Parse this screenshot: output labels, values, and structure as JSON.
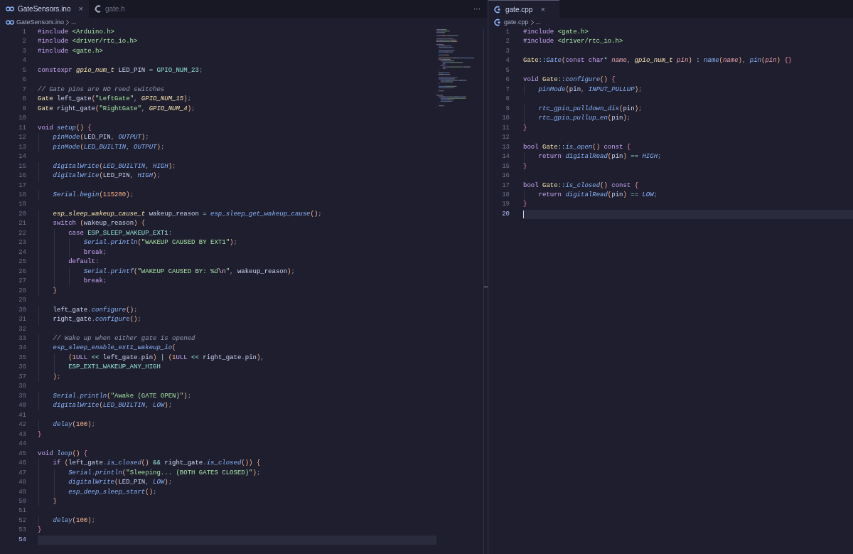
{
  "panes": [
    {
      "focused": false,
      "more_actions": "···",
      "tabs": [
        {
          "label": "GateSensors.ino",
          "kind": "ino",
          "selected": true,
          "close": "×"
        },
        {
          "label": "gate.h",
          "kind": "h",
          "selected": false
        }
      ],
      "breadcrumb": {
        "kind": "ino",
        "items": [
          "GateSensors.ino",
          "..."
        ]
      },
      "lines": [
        {
          "n": "1",
          "current": false,
          "tokens": [
            {
              "text": "#include ",
              "kind": "kw"
            },
            {
              "text": "<Arduino.h>",
              "kind": "str"
            }
          ]
        },
        {
          "n": "2",
          "current": false,
          "tokens": [
            {
              "text": "#include ",
              "kind": "kw"
            },
            {
              "text": "<driver/rtc_io.h>",
              "kind": "str"
            }
          ]
        },
        {
          "n": "3",
          "current": false,
          "tokens": [
            {
              "text": "#include ",
              "kind": "kw"
            },
            {
              "text": "<gate.h>",
              "kind": "str"
            }
          ]
        },
        {
          "n": "4",
          "current": false
        },
        {
          "n": "5",
          "current": false,
          "tokens": [
            {
              "text": "constexpr ",
              "kind": "kw"
            },
            {
              "text": "gpio_num_t",
              "kind": "type"
            },
            {
              "text": " LED_PIN ",
              "kind": "var"
            },
            {
              "text": "= ",
              "kind": "op"
            },
            {
              "text": "GPIO_NUM_23",
              "kind": "const"
            },
            {
              "text": ";",
              "kind": "punc"
            }
          ]
        },
        {
          "n": "6",
          "current": false
        },
        {
          "n": "7",
          "current": false,
          "tokens": [
            {
              "text": "// Gate pins are NO reed switches",
              "kind": "com"
            }
          ]
        },
        {
          "n": "8",
          "current": false,
          "tokens": [
            {
              "text": "Gate",
              "kind": "cls"
            },
            {
              "text": " left_gate",
              "kind": "var"
            },
            {
              "text": "(",
              "kind": "paren"
            },
            {
              "text": "\"LeftGate\"",
              "kind": "str"
            },
            {
              "text": ", ",
              "kind": "punc"
            },
            {
              "text": "GPIO_NUM_15",
              "kind": "type"
            },
            {
              "text": ")",
              "kind": "paren"
            },
            {
              "text": ";",
              "kind": "punc"
            }
          ]
        },
        {
          "n": "9",
          "current": false,
          "tokens": [
            {
              "text": "Gate",
              "kind": "cls"
            },
            {
              "text": " right_gate",
              "kind": "var"
            },
            {
              "text": "(",
              "kind": "paren"
            },
            {
              "text": "\"RightGate\"",
              "kind": "str"
            },
            {
              "text": ", ",
              "kind": "punc"
            },
            {
              "text": "GPIO_NUM_4",
              "kind": "type"
            },
            {
              "text": ")",
              "kind": "paren"
            },
            {
              "text": ";",
              "kind": "punc"
            }
          ]
        },
        {
          "n": "10",
          "current": false
        },
        {
          "n": "11",
          "current": false,
          "tokens": [
            {
              "text": "void ",
              "kind": "kw"
            },
            {
              "text": "setup",
              "kind": "fn"
            },
            {
              "text": "() ",
              "kind": "paren"
            },
            {
              "text": "{",
              "kind": "brace"
            }
          ]
        },
        {
          "n": "12",
          "current": false,
          "tokens": [
            {
              "text": "    pinMode",
              "kind": "fn"
            },
            {
              "text": "(",
              "kind": "paren"
            },
            {
              "text": "LED_PIN",
              "kind": "var"
            },
            {
              "text": ", ",
              "kind": "punc"
            },
            {
              "text": "OUTPUT",
              "kind": "mac"
            },
            {
              "text": ")",
              "kind": "paren"
            },
            {
              "text": ";",
              "kind": "punc"
            }
          ]
        },
        {
          "n": "13",
          "current": false,
          "tokens": [
            {
              "text": "    pinMode",
              "kind": "fn"
            },
            {
              "text": "(",
              "kind": "paren"
            },
            {
              "text": "LED_BUILTIN",
              "kind": "mac"
            },
            {
              "text": ", ",
              "kind": "punc"
            },
            {
              "text": "OUTPUT",
              "kind": "mac"
            },
            {
              "text": ")",
              "kind": "paren"
            },
            {
              "text": ";",
              "kind": "punc"
            }
          ]
        },
        {
          "n": "14",
          "current": false
        },
        {
          "n": "15",
          "current": false,
          "tokens": [
            {
              "text": "    digitalWrite",
              "kind": "fn"
            },
            {
              "text": "(",
              "kind": "paren"
            },
            {
              "text": "LED_BUILTIN",
              "kind": "mac"
            },
            {
              "text": ", ",
              "kind": "punc"
            },
            {
              "text": "HIGH",
              "kind": "mac"
            },
            {
              "text": ")",
              "kind": "paren"
            },
            {
              "text": ";",
              "kind": "punc"
            }
          ]
        },
        {
          "n": "16",
          "current": false,
          "tokens": [
            {
              "text": "    digitalWrite",
              "kind": "fn"
            },
            {
              "text": "(",
              "kind": "paren"
            },
            {
              "text": "LED_PIN",
              "kind": "var"
            },
            {
              "text": ", ",
              "kind": "punc"
            },
            {
              "text": "HIGH",
              "kind": "mac"
            },
            {
              "text": ")",
              "kind": "paren"
            },
            {
              "text": ";",
              "kind": "punc"
            }
          ]
        },
        {
          "n": "17",
          "current": false
        },
        {
          "n": "18",
          "current": false,
          "tokens": [
            {
              "text": "    Serial",
              "kind": "mac"
            },
            {
              "text": ".",
              "kind": "punc"
            },
            {
              "text": "begin",
              "kind": "fn"
            },
            {
              "text": "(",
              "kind": "paren"
            },
            {
              "text": "115200",
              "kind": "num"
            },
            {
              "text": ")",
              "kind": "paren"
            },
            {
              "text": ";",
              "kind": "punc"
            }
          ]
        },
        {
          "n": "19",
          "current": false
        },
        {
          "n": "20",
          "current": false,
          "tokens": [
            {
              "text": "    esp_sleep_wakeup_cause_t",
              "kind": "type"
            },
            {
              "text": " wakeup_reason ",
              "kind": "var"
            },
            {
              "text": "= ",
              "kind": "op"
            },
            {
              "text": "esp_sleep_get_wakeup_cause",
              "kind": "fn"
            },
            {
              "text": "()",
              "kind": "paren"
            },
            {
              "text": ";",
              "kind": "punc"
            }
          ]
        },
        {
          "n": "21",
          "current": false,
          "tokens": [
            {
              "text": "    switch ",
              "kind": "kw"
            },
            {
              "text": "(",
              "kind": "paren"
            },
            {
              "text": "wakeup_reason",
              "kind": "var"
            },
            {
              "text": ") {",
              "kind": "paren"
            }
          ]
        },
        {
          "n": "22",
          "current": false,
          "tokens": [
            {
              "text": "        case ",
              "kind": "kw"
            },
            {
              "text": "ESP_SLEEP_WAKEUP_EXT1",
              "kind": "const"
            },
            {
              "text": ":",
              "kind": "punc"
            }
          ]
        },
        {
          "n": "23",
          "current": false,
          "tokens": [
            {
              "text": "            Serial",
              "kind": "mac"
            },
            {
              "text": ".",
              "kind": "punc"
            },
            {
              "text": "println",
              "kind": "fn"
            },
            {
              "text": "(",
              "kind": "paren"
            },
            {
              "text": "\"WAKEUP CAUSED BY EXT1\"",
              "kind": "str"
            },
            {
              "text": ")",
              "kind": "paren"
            },
            {
              "text": ";",
              "kind": "punc"
            }
          ]
        },
        {
          "n": "24",
          "current": false,
          "tokens": [
            {
              "text": "            break",
              "kind": "kw"
            },
            {
              "text": ";",
              "kind": "punc"
            }
          ]
        },
        {
          "n": "25",
          "current": false,
          "tokens": [
            {
              "text": "        default",
              "kind": "kw"
            },
            {
              "text": ":",
              "kind": "punc"
            }
          ]
        },
        {
          "n": "26",
          "current": false,
          "tokens": [
            {
              "text": "            Serial",
              "kind": "mac"
            },
            {
              "text": ".",
              "kind": "punc"
            },
            {
              "text": "printf",
              "kind": "fn"
            },
            {
              "text": "(",
              "kind": "paren"
            },
            {
              "text": "\"WAKEUP CAUSED BY: %d",
              "kind": "str"
            },
            {
              "text": "\\n",
              "kind": "esc"
            },
            {
              "text": "\"",
              "kind": "str"
            },
            {
              "text": ",",
              "kind": "punc"
            },
            {
              "text": " wakeup_reason",
              "kind": "var"
            },
            {
              "text": ")",
              "kind": "paren"
            },
            {
              "text": ";",
              "kind": "punc"
            }
          ]
        },
        {
          "n": "27",
          "current": false,
          "tokens": [
            {
              "text": "            break",
              "kind": "kw"
            },
            {
              "text": ";",
              "kind": "punc"
            }
          ]
        },
        {
          "n": "28",
          "current": false,
          "tokens": [
            {
              "text": "    }",
              "kind": "paren"
            }
          ]
        },
        {
          "n": "29",
          "current": false
        },
        {
          "n": "30",
          "current": false,
          "tokens": [
            {
              "text": "    left_gate",
              "kind": "var"
            },
            {
              "text": ".",
              "kind": "punc"
            },
            {
              "text": "configure",
              "kind": "fn"
            },
            {
              "text": "()",
              "kind": "paren"
            },
            {
              "text": ";",
              "kind": "punc"
            }
          ]
        },
        {
          "n": "31",
          "current": false,
          "tokens": [
            {
              "text": "    right_gate",
              "kind": "var"
            },
            {
              "text": ".",
              "kind": "punc"
            },
            {
              "text": "configure",
              "kind": "fn"
            },
            {
              "text": "()",
              "kind": "paren"
            },
            {
              "text": ";",
              "kind": "punc"
            }
          ]
        },
        {
          "n": "32",
          "current": false
        },
        {
          "n": "33",
          "current": false,
          "tokens": [
            {
              "text": "    // Wake up when either gate is opened",
              "kind": "com"
            }
          ]
        },
        {
          "n": "34",
          "current": false,
          "tokens": [
            {
              "text": "    esp_sleep_enable_ext1_wakeup_io",
              "kind": "fn"
            },
            {
              "text": "(",
              "kind": "paren"
            }
          ]
        },
        {
          "n": "35",
          "current": false,
          "tokens": [
            {
              "text": "        (",
              "kind": "paren"
            },
            {
              "text": "1",
              "kind": "num"
            },
            {
              "text": "ULL ",
              "kind": "kw"
            },
            {
              "text": "<<",
              "kind": "op"
            },
            {
              "text": " left_gate",
              "kind": "var"
            },
            {
              "text": ".",
              "kind": "punc"
            },
            {
              "text": "pin",
              "kind": "var"
            },
            {
              "text": ") ",
              "kind": "paren"
            },
            {
              "text": "| ",
              "kind": "op"
            },
            {
              "text": "(",
              "kind": "paren"
            },
            {
              "text": "1",
              "kind": "num"
            },
            {
              "text": "ULL ",
              "kind": "kw"
            },
            {
              "text": "<<",
              "kind": "op"
            },
            {
              "text": " right_gate",
              "kind": "var"
            },
            {
              "text": ".",
              "kind": "punc"
            },
            {
              "text": "pin",
              "kind": "var"
            },
            {
              "text": ")",
              "kind": "paren"
            },
            {
              "text": ",",
              "kind": "punc"
            }
          ]
        },
        {
          "n": "36",
          "current": false,
          "tokens": [
            {
              "text": "        ESP_EXT1_WAKEUP_ANY_HIGH",
              "kind": "const"
            }
          ]
        },
        {
          "n": "37",
          "current": false,
          "tokens": [
            {
              "text": "    )",
              "kind": "paren"
            },
            {
              "text": ";",
              "kind": "punc"
            }
          ]
        },
        {
          "n": "38",
          "current": false
        },
        {
          "n": "39",
          "current": false,
          "tokens": [
            {
              "text": "    Serial",
              "kind": "mac"
            },
            {
              "text": ".",
              "kind": "punc"
            },
            {
              "text": "println",
              "kind": "fn"
            },
            {
              "text": "(",
              "kind": "paren"
            },
            {
              "text": "\"Awake (GATE OPEN)\"",
              "kind": "str"
            },
            {
              "text": ")",
              "kind": "paren"
            },
            {
              "text": ";",
              "kind": "punc"
            }
          ]
        },
        {
          "n": "40",
          "current": false,
          "tokens": [
            {
              "text": "    digitalWrite",
              "kind": "fn"
            },
            {
              "text": "(",
              "kind": "paren"
            },
            {
              "text": "LED_BUILTIN",
              "kind": "mac"
            },
            {
              "text": ", ",
              "kind": "punc"
            },
            {
              "text": "LOW",
              "kind": "mac"
            },
            {
              "text": ")",
              "kind": "paren"
            },
            {
              "text": ";",
              "kind": "punc"
            }
          ]
        },
        {
          "n": "41",
          "current": false
        },
        {
          "n": "42",
          "current": false,
          "tokens": [
            {
              "text": "    delay",
              "kind": "fn"
            },
            {
              "text": "(",
              "kind": "paren"
            },
            {
              "text": "100",
              "kind": "num"
            },
            {
              "text": ")",
              "kind": "paren"
            },
            {
              "text": ";",
              "kind": "punc"
            }
          ]
        },
        {
          "n": "43",
          "current": false,
          "tokens": [
            {
              "text": "}",
              "kind": "brace"
            }
          ]
        },
        {
          "n": "44",
          "current": false
        },
        {
          "n": "45",
          "current": false,
          "tokens": [
            {
              "text": "void ",
              "kind": "kw"
            },
            {
              "text": "loop",
              "kind": "fn"
            },
            {
              "text": "() ",
              "kind": "paren"
            },
            {
              "text": "{",
              "kind": "brace"
            }
          ]
        },
        {
          "n": "46",
          "current": false,
          "tokens": [
            {
              "text": "    if ",
              "kind": "kw"
            },
            {
              "text": "(",
              "kind": "paren"
            },
            {
              "text": "left_gate",
              "kind": "var"
            },
            {
              "text": ".",
              "kind": "punc"
            },
            {
              "text": "is_closed",
              "kind": "fn"
            },
            {
              "text": "() ",
              "kind": "paren"
            },
            {
              "text": "&&",
              "kind": "op"
            },
            {
              "text": " right_gate",
              "kind": "var"
            },
            {
              "text": ".",
              "kind": "punc"
            },
            {
              "text": "is_closed",
              "kind": "fn"
            },
            {
              "text": "()) {",
              "kind": "paren"
            }
          ]
        },
        {
          "n": "47",
          "current": false,
          "tokens": [
            {
              "text": "        Serial",
              "kind": "mac"
            },
            {
              "text": ".",
              "kind": "punc"
            },
            {
              "text": "println",
              "kind": "fn"
            },
            {
              "text": "(",
              "kind": "paren"
            },
            {
              "text": "\"Sleeping... (BOTH GATES CLOSED)\"",
              "kind": "str"
            },
            {
              "text": ")",
              "kind": "paren"
            },
            {
              "text": ";",
              "kind": "punc"
            }
          ]
        },
        {
          "n": "48",
          "current": false,
          "tokens": [
            {
              "text": "        digitalWrite",
              "kind": "fn"
            },
            {
              "text": "(",
              "kind": "paren"
            },
            {
              "text": "LED_PIN",
              "kind": "var"
            },
            {
              "text": ", ",
              "kind": "punc"
            },
            {
              "text": "LOW",
              "kind": "mac"
            },
            {
              "text": ")",
              "kind": "paren"
            },
            {
              "text": ";",
              "kind": "punc"
            }
          ]
        },
        {
          "n": "49",
          "current": false,
          "tokens": [
            {
              "text": "        esp_deep_sleep_start",
              "kind": "fn"
            },
            {
              "text": "()",
              "kind": "paren"
            },
            {
              "text": ";",
              "kind": "punc"
            }
          ]
        },
        {
          "n": "50",
          "current": false,
          "tokens": [
            {
              "text": "    }",
              "kind": "paren"
            }
          ]
        },
        {
          "n": "51",
          "current": false
        },
        {
          "n": "52",
          "current": false,
          "tokens": [
            {
              "text": "    delay",
              "kind": "fn"
            },
            {
              "text": "(",
              "kind": "paren"
            },
            {
              "text": "100",
              "kind": "num"
            },
            {
              "text": ")",
              "kind": "paren"
            },
            {
              "text": ";",
              "kind": "punc"
            }
          ]
        },
        {
          "n": "53",
          "current": false,
          "tokens": [
            {
              "text": "}",
              "kind": "brace"
            }
          ]
        },
        {
          "n": "54",
          "current": true
        }
      ]
    },
    {
      "focused": true,
      "tabs": [
        {
          "label": "gate.cpp",
          "kind": "cpp",
          "selected": true,
          "close": "×"
        }
      ],
      "breadcrumb": {
        "kind": "cpp",
        "items": [
          "gate.cpp",
          "..."
        ]
      },
      "lines": [
        {
          "n": "1",
          "current": false,
          "tokens": [
            {
              "text": "#include ",
              "kind": "kw"
            },
            {
              "text": "<gate.h>",
              "kind": "str"
            }
          ]
        },
        {
          "n": "2",
          "current": false,
          "tokens": [
            {
              "text": "#include ",
              "kind": "kw"
            },
            {
              "text": "<driver/rtc_io.h>",
              "kind": "str"
            }
          ]
        },
        {
          "n": "3",
          "current": false
        },
        {
          "n": "4",
          "current": false,
          "tokens": [
            {
              "text": "Gate",
              "kind": "cls"
            },
            {
              "text": "::",
              "kind": "op"
            },
            {
              "text": "Gate",
              "kind": "fn"
            },
            {
              "text": "(",
              "kind": "paren"
            },
            {
              "text": "const char",
              "kind": "kw"
            },
            {
              "text": "* ",
              "kind": "op"
            },
            {
              "text": "name",
              "kind": "param"
            },
            {
              "text": ", ",
              "kind": "punc"
            },
            {
              "text": "gpio_num_t ",
              "kind": "type"
            },
            {
              "text": "pin",
              "kind": "param"
            },
            {
              "text": ") ",
              "kind": "paren"
            },
            {
              "text": ": ",
              "kind": "op"
            },
            {
              "text": "name",
              "kind": "fn"
            },
            {
              "text": "(",
              "kind": "paren"
            },
            {
              "text": "name",
              "kind": "param"
            },
            {
              "text": ")",
              "kind": "paren"
            },
            {
              "text": ", ",
              "kind": "punc"
            },
            {
              "text": "pin",
              "kind": "fn"
            },
            {
              "text": "(",
              "kind": "paren"
            },
            {
              "text": "pin",
              "kind": "param"
            },
            {
              "text": ") ",
              "kind": "paren"
            },
            {
              "text": "{}",
              "kind": "brace"
            }
          ]
        },
        {
          "n": "5",
          "current": false
        },
        {
          "n": "6",
          "current": false,
          "tokens": [
            {
              "text": "void ",
              "kind": "kw"
            },
            {
              "text": "Gate",
              "kind": "cls"
            },
            {
              "text": "::",
              "kind": "op"
            },
            {
              "text": "configure",
              "kind": "fn"
            },
            {
              "text": "() ",
              "kind": "paren"
            },
            {
              "text": "{",
              "kind": "brace"
            }
          ]
        },
        {
          "n": "7",
          "current": false,
          "tokens": [
            {
              "text": "    pinMode",
              "kind": "fn"
            },
            {
              "text": "(",
              "kind": "paren"
            },
            {
              "text": "pin",
              "kind": "var"
            },
            {
              "text": ", ",
              "kind": "punc"
            },
            {
              "text": "INPUT_PULLUP",
              "kind": "mac"
            },
            {
              "text": ")",
              "kind": "paren"
            },
            {
              "text": ";",
              "kind": "punc"
            }
          ]
        },
        {
          "n": "8",
          "current": false
        },
        {
          "n": "9",
          "current": false,
          "tokens": [
            {
              "text": "    rtc_gpio_pulldown_dis",
              "kind": "fn"
            },
            {
              "text": "(",
              "kind": "paren"
            },
            {
              "text": "pin",
              "kind": "var"
            },
            {
              "text": ")",
              "kind": "paren"
            },
            {
              "text": ";",
              "kind": "punc"
            }
          ]
        },
        {
          "n": "10",
          "current": false,
          "tokens": [
            {
              "text": "    rtc_gpio_pullup_en",
              "kind": "fn"
            },
            {
              "text": "(",
              "kind": "paren"
            },
            {
              "text": "pin",
              "kind": "var"
            },
            {
              "text": ")",
              "kind": "paren"
            },
            {
              "text": ";",
              "kind": "punc"
            }
          ]
        },
        {
          "n": "11",
          "current": false,
          "tokens": [
            {
              "text": "}",
              "kind": "brace"
            }
          ]
        },
        {
          "n": "12",
          "current": false
        },
        {
          "n": "13",
          "current": false,
          "tokens": [
            {
              "text": "bool ",
              "kind": "kw"
            },
            {
              "text": "Gate",
              "kind": "cls"
            },
            {
              "text": "::",
              "kind": "op"
            },
            {
              "text": "is_open",
              "kind": "fn"
            },
            {
              "text": "() ",
              "kind": "paren"
            },
            {
              "text": "const ",
              "kind": "kw"
            },
            {
              "text": "{",
              "kind": "brace"
            }
          ]
        },
        {
          "n": "14",
          "current": false,
          "tokens": [
            {
              "text": "    return ",
              "kind": "kw"
            },
            {
              "text": "digitalRead",
              "kind": "fn"
            },
            {
              "text": "(",
              "kind": "paren"
            },
            {
              "text": "pin",
              "kind": "var"
            },
            {
              "text": ") ",
              "kind": "paren"
            },
            {
              "text": "== ",
              "kind": "op"
            },
            {
              "text": "HIGH",
              "kind": "mac"
            },
            {
              "text": ";",
              "kind": "punc"
            }
          ]
        },
        {
          "n": "15",
          "current": false,
          "tokens": [
            {
              "text": "}",
              "kind": "brace"
            }
          ]
        },
        {
          "n": "16",
          "current": false
        },
        {
          "n": "17",
          "current": false,
          "tokens": [
            {
              "text": "bool ",
              "kind": "kw"
            },
            {
              "text": "Gate",
              "kind": "cls"
            },
            {
              "text": "::",
              "kind": "op"
            },
            {
              "text": "is_closed",
              "kind": "fn"
            },
            {
              "text": "() ",
              "kind": "paren"
            },
            {
              "text": "const ",
              "kind": "kw"
            },
            {
              "text": "{",
              "kind": "brace"
            }
          ]
        },
        {
          "n": "18",
          "current": false,
          "tokens": [
            {
              "text": "    return ",
              "kind": "kw"
            },
            {
              "text": "digitalRead",
              "kind": "fn"
            },
            {
              "text": "(",
              "kind": "paren"
            },
            {
              "text": "pin",
              "kind": "var"
            },
            {
              "text": ") ",
              "kind": "paren"
            },
            {
              "text": "== ",
              "kind": "op"
            },
            {
              "text": "LOW",
              "kind": "mac"
            },
            {
              "text": ";",
              "kind": "punc"
            }
          ]
        },
        {
          "n": "19",
          "current": false,
          "tokens": [
            {
              "text": "}",
              "kind": "brace"
            }
          ]
        },
        {
          "n": "20",
          "current": true
        }
      ]
    }
  ]
}
